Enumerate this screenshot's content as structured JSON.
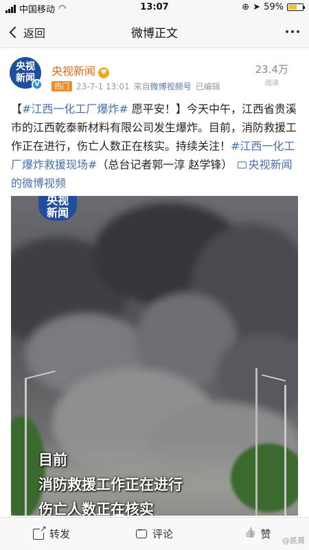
{
  "status_bar": {
    "carrier": "中国移动",
    "time": "13:07",
    "battery": "59%",
    "battery_level": 0.59,
    "icons": [
      "signal-icon",
      "wifi-icon",
      "lock-rotation-icon",
      "location-icon",
      "battery-icon"
    ]
  },
  "nav": {
    "back_label": "返回",
    "title": "微博正文",
    "more_icon": "more-dots-icon"
  },
  "post": {
    "avatar_text_line1": "央视",
    "avatar_text_line2": "新闻",
    "author": "央视新闻",
    "vip_badge": "♥",
    "hot_tag": "热门",
    "date": "23-7-1 13:01",
    "source_prefix": "来自",
    "source": "微博视频号",
    "edited": "已编辑",
    "read_count": "23.4万",
    "read_label": "阅读",
    "text": {
      "bracket_open": "【",
      "topic1": "#江西一化工厂爆炸#",
      "wish": " 愿平安！】",
      "body": "今天中午，江西省贵溪市的江西乾泰新材料有限公司发生爆炸。目前，消防救援工作正在进行，伤亡人数正在核实。持续关注！",
      "topic2": "#江西一化工厂爆炸救援现场#",
      "credit": "（总台记者郭一淳 赵学锋）",
      "video_link": "央视新闻的微博视频"
    }
  },
  "media": {
    "logo_line1": "央视",
    "logo_line2": "新闻",
    "caption_line1": "目前",
    "caption_line2": "消防救援工作正在进行",
    "caption_line3": "伤亡人数正在核实"
  },
  "actions": {
    "repost": "转发",
    "comment": "评论",
    "like": "赞",
    "watermark": "@凯哥"
  },
  "colors": {
    "accent_orange": "#e8650b",
    "link_blue": "#4670ae",
    "hot_tag": "#f08a2a",
    "brand_blue": "#1f4f9c"
  }
}
